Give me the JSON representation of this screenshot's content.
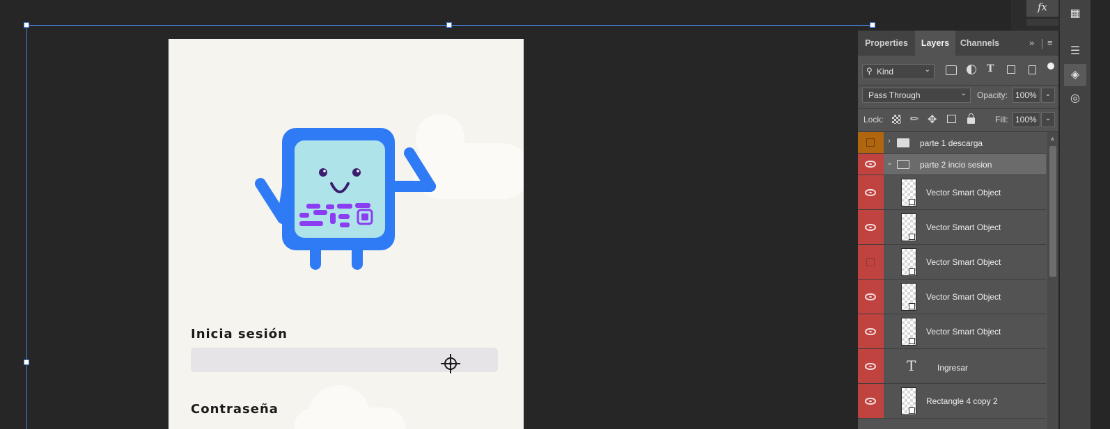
{
  "panel": {
    "tabs": [
      {
        "label": "Properties",
        "active": false
      },
      {
        "label": "Layers",
        "active": true
      },
      {
        "label": "Channels",
        "active": false
      }
    ],
    "filter_kind": "Kind",
    "blend_mode": "Pass Through",
    "opacity_label": "Opacity:",
    "opacity_value": "100%",
    "lock_label": "Lock:",
    "fill_label": "Fill:",
    "fill_value": "100%",
    "layers": [
      {
        "name": "parte 1 descarga",
        "type": "group-collapsed",
        "visible": false
      },
      {
        "name": "parte 2 incio sesion",
        "type": "group-expanded",
        "visible": true
      },
      {
        "name": "Vector Smart Object",
        "type": "smart",
        "visible": true
      },
      {
        "name": "Vector Smart Object",
        "type": "smart",
        "visible": true
      },
      {
        "name": "Vector Smart Object",
        "type": "smart",
        "visible": false
      },
      {
        "name": "Vector Smart Object",
        "type": "smart",
        "visible": true
      },
      {
        "name": "Vector Smart Object",
        "type": "smart",
        "visible": true
      },
      {
        "name": "Ingresar",
        "type": "text",
        "visible": true
      },
      {
        "name": "Rectangle 4 copy 2",
        "type": "shape",
        "visible": true
      }
    ]
  },
  "artboard": {
    "login_title": "Inicia sesión",
    "password_title": "Contraseña"
  },
  "toolbar": {
    "fx_label": "fx"
  },
  "colors": {
    "eye_column": "#c1433f",
    "group_color_orange": "#b0650f",
    "selection": "#4a7fd6",
    "robot_blue": "#2f7bf5",
    "robot_screen": "#aee3ea",
    "qr_purple": "#8b3df2"
  }
}
